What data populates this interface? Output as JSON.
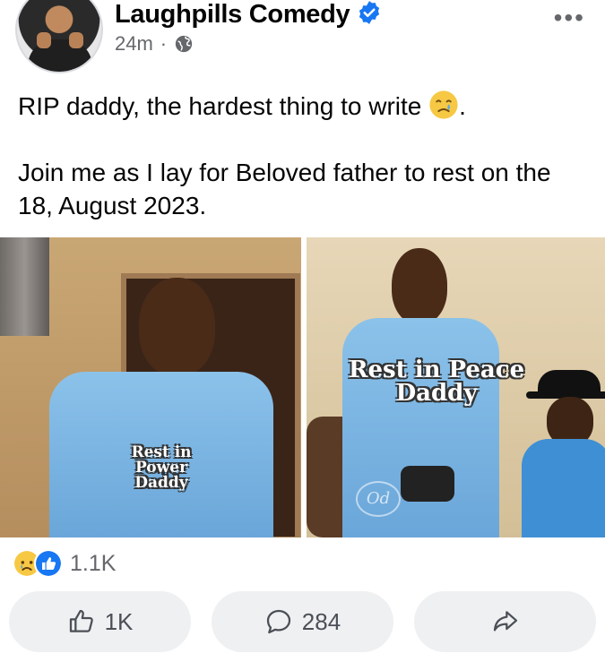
{
  "post": {
    "author": "Laughpills Comedy",
    "time": "24m",
    "separator": "·",
    "more_label": "•••",
    "text_line1": "RIP daddy, the hardest thing to  write",
    "text_line1_end": ".",
    "text_line2": "Join me as I lay for Beloved father to rest on the 18, August 2023."
  },
  "photos": {
    "left_caption_line1": "Rest in Power",
    "left_caption_line2": "Daddy",
    "right_caption_line1": "Rest in Peace",
    "right_caption_line2": "Daddy",
    "watermark": "Od"
  },
  "reactions": {
    "count": "1.1K",
    "icons": [
      "sad-react-icon",
      "like-react-icon"
    ]
  },
  "actions": {
    "like_count": "1K",
    "comment_count": "284"
  },
  "colors": {
    "facebook_blue": "#1877f2",
    "secondary_text": "#65676b",
    "button_bg": "#eff0f2"
  }
}
